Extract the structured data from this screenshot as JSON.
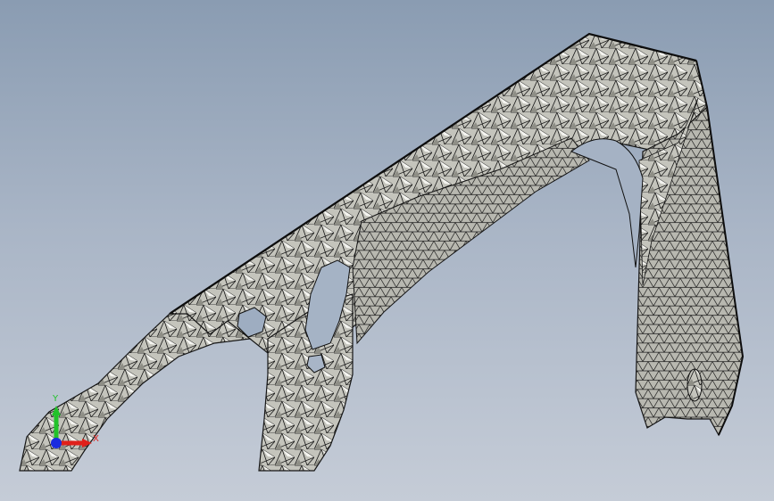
{
  "viewport": {
    "background_top": "#8a9cb2",
    "background_bottom": "#c5ccd7",
    "model": "triangulated-mesh",
    "mesh_fill": "#b5b5ad",
    "mesh_edge": "#1c1c1c"
  },
  "triad": {
    "x_label": "X",
    "y_label": "Y",
    "x_color": "#e0201a",
    "y_color": "#22c22a",
    "z_color": "#1a2be0"
  }
}
